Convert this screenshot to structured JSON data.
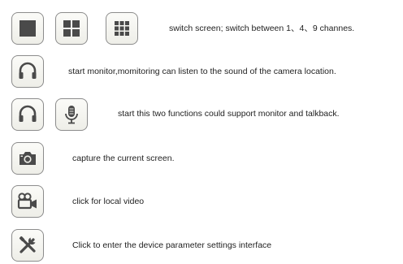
{
  "rows": [
    {
      "buttons": [
        {
          "icon": "single-screen-icon"
        },
        {
          "icon": "four-screen-icon"
        },
        {
          "icon": "nine-screen-icon"
        }
      ],
      "description": "switch screen; switch between 1、4、9 channes."
    },
    {
      "buttons": [
        {
          "icon": "headphones-icon"
        }
      ],
      "description": "start monitor,momitoring can listen to the sound of the camera location."
    },
    {
      "buttons": [
        {
          "icon": "headphones-icon"
        },
        {
          "icon": "microphone-icon"
        }
      ],
      "description": "start this two functions could support monitor and talkback."
    },
    {
      "buttons": [
        {
          "icon": "camera-icon"
        }
      ],
      "description": "capture the current screen."
    },
    {
      "buttons": [
        {
          "icon": "video-camera-icon"
        }
      ],
      "description": "click for local video"
    },
    {
      "buttons": [
        {
          "icon": "settings-tools-icon"
        }
      ],
      "description": "Click to enter the device parameter settings interface"
    }
  ],
  "colors": {
    "icon": "#4a4a4a",
    "button_border": "#8c8c8c"
  }
}
